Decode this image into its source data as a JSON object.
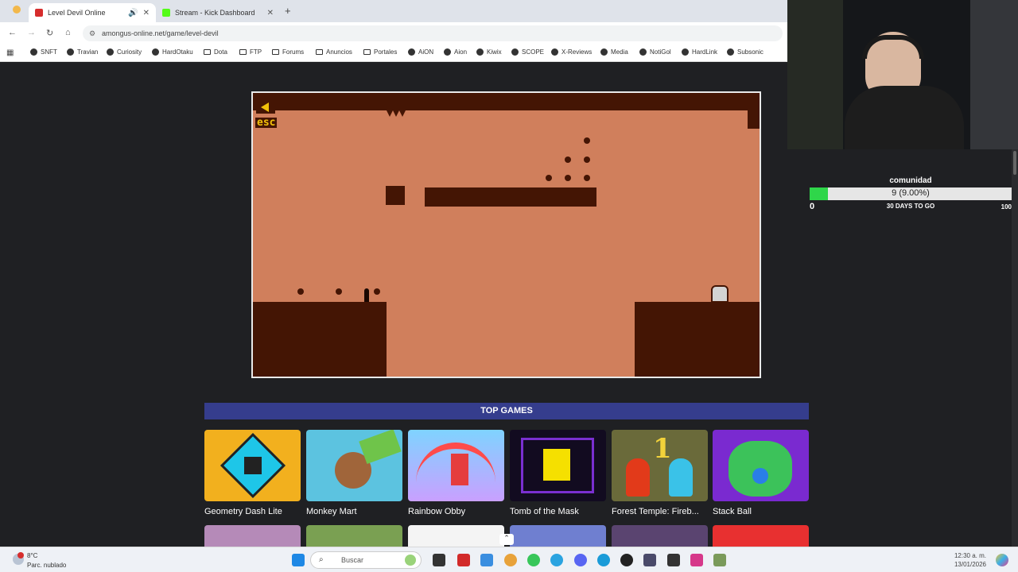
{
  "browser": {
    "tabs": [
      {
        "title": "Level Devil Online",
        "favicon_color": "#d62d2d"
      },
      {
        "title": "Stream - Kick Dashboard",
        "favicon_color": "#53fc18"
      }
    ],
    "url": "amongus-online.net/game/level-devil",
    "bookmarks": [
      "SNFT",
      "Travian",
      "Curiosity",
      "HardOtaku",
      "Dota",
      "FTP",
      "Forums",
      "Anuncios",
      "Portales",
      "AiON",
      "Aion",
      "Kiwix",
      "SCOPE",
      "X-Reviews",
      "Media",
      "NotiGol",
      "HardLink",
      "Subsonic"
    ]
  },
  "game": {
    "name": "Level Devil",
    "esc_label": "esc",
    "colors": {
      "background": "#d07f5c",
      "terrain": "#441504",
      "accent": "#f2c10a"
    }
  },
  "top_games": {
    "header": "TOP GAMES",
    "items": [
      {
        "name": "Geometry Dash Lite"
      },
      {
        "name": "Monkey Mart"
      },
      {
        "name": "Rainbow Obby"
      },
      {
        "name": "Tomb of the Mask"
      },
      {
        "name": "Forest Temple: Fireb..."
      },
      {
        "name": "Stack Ball"
      }
    ]
  },
  "goal": {
    "title": "comunidad",
    "value_text": "9 (9.00%)",
    "progress": 0.09,
    "min": "0",
    "max": "100",
    "days_left": "30 DAYS TO GO"
  },
  "taskbar": {
    "weather_temp": "8°C",
    "weather_condition": "Parc. nublado",
    "search_placeholder": "Buscar",
    "time": "12:30 a. m.",
    "date": "13/01/2026"
  }
}
